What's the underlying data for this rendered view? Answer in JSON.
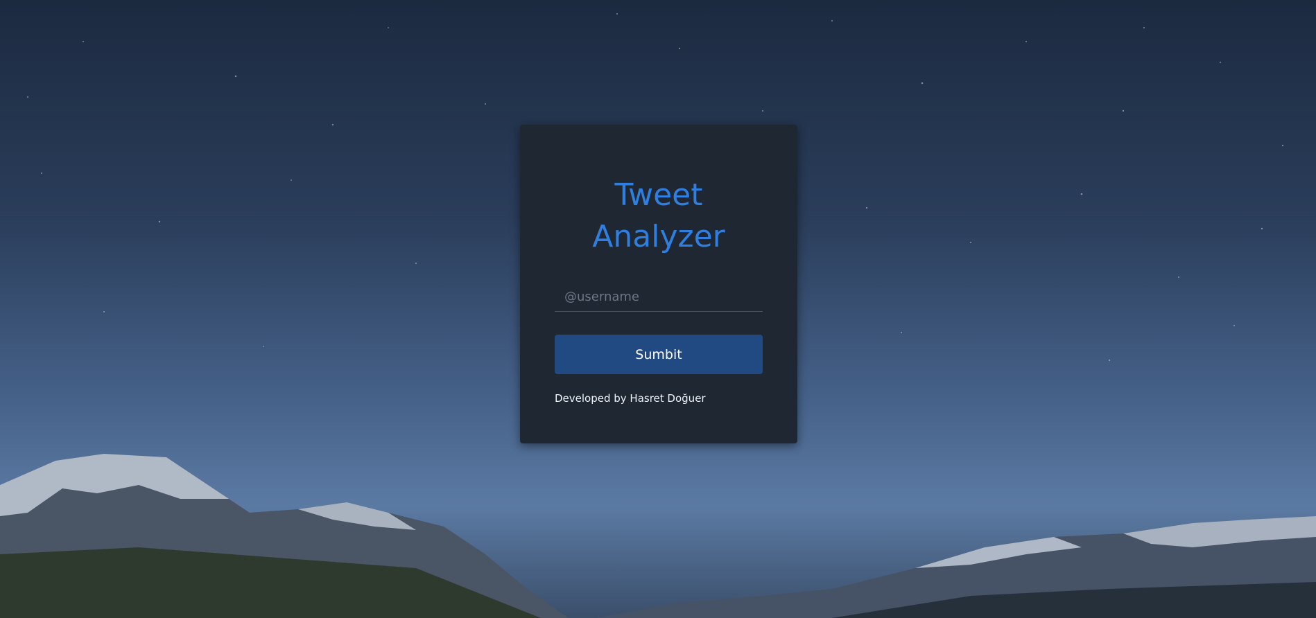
{
  "app": {
    "title_line1": "Tweet",
    "title_line2": "Analyzer"
  },
  "form": {
    "username_placeholder": "@username",
    "username_value": "",
    "submit_label": "Sumbit"
  },
  "footer": {
    "credit": "Developed by Hasret Doğuer"
  },
  "colors": {
    "accent": "#2f7fe0",
    "card_background": "#1f2733",
    "button_background": "#214a83"
  }
}
